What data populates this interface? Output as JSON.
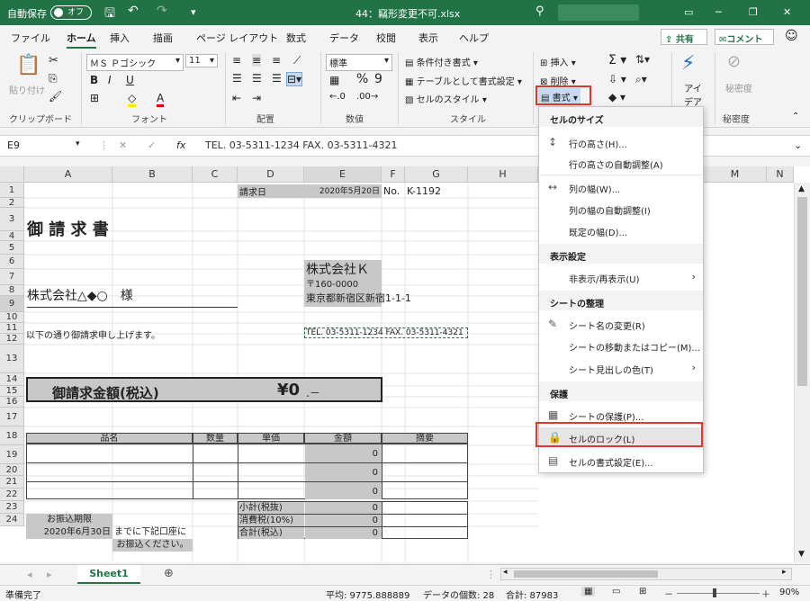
{
  "title": {
    "autosave": "自動保存",
    "toggle": "オフ",
    "filename": "44：竊形変更不可.xlsx"
  },
  "tabs": [
    "ファイル",
    "ホーム",
    "挿入",
    "描画",
    "ページ レイアウト",
    "数式",
    "データ",
    "校閲",
    "表示",
    "ヘルプ"
  ],
  "share": "共有",
  "comment": "コメント",
  "ribbon": {
    "clipboard": {
      "paste": "貼り付け",
      "group": "クリップボード"
    },
    "font": {
      "name": "ＭＳ Ｐゴシック",
      "size": "11",
      "group": "フォント"
    },
    "align": {
      "group": "配置"
    },
    "number": {
      "format": "標準",
      "group": "数値"
    },
    "style": {
      "cond": "条件付き書式",
      "table": "テーブルとして書式設定",
      "cell": "セルのスタイル",
      "group": "スタイル"
    },
    "cells": {
      "insert": "挿入",
      "delete": "削除",
      "format": "書式"
    },
    "ideas": "アイデア",
    "sensitivity": "秘密度"
  },
  "formula": {
    "namebox": "E9",
    "fx": "fx",
    "content": "TEL. 03-5311-1234 FAX. 03-5311-4321"
  },
  "columns": [
    "A",
    "B",
    "C",
    "D",
    "E",
    "F",
    "G",
    "H",
    "M",
    "N"
  ],
  "rows": [
    "1",
    "2",
    "3",
    "4",
    "5",
    "6",
    "7",
    "8",
    "9",
    "10",
    "11",
    "12",
    "13",
    "14",
    "15",
    "16",
    "17",
    "18",
    "19",
    "20",
    "21",
    "22",
    "23",
    "24"
  ],
  "sheet": {
    "d1": "請求日",
    "e1": "2020年5月20日",
    "f1": "No.",
    "g1": "K-1192",
    "a3": "御 請 求 書",
    "e5": "株式会社Ｋ",
    "e6": "〒160-0000",
    "e7": "東京都新宿区新宿1-1-1",
    "a7": "株式会社△◆○　様",
    "a9": "以下の通り御請求申し上げます。",
    "e9": "TEL. 03-5311-1234 FAX. 03-5311-4321",
    "a13": "御請求金額(税込)",
    "d13": "¥0",
    "e13": ".－",
    "h16": [
      "品名",
      "数量",
      "単価",
      "金額",
      "摘要"
    ],
    "zero": "0",
    "d20": "小計(税抜)",
    "d21": "消費税(10%)",
    "d22": "合計(税込)",
    "a21": "お振込期限",
    "a22": "2020年6月30日",
    "b22": "までに下記口座に",
    "b23": "お振込ください。"
  },
  "dropdown": {
    "h1": "セルのサイズ",
    "i1": "行の高さ(H)...",
    "i2": "行の高さの自動調整(A)",
    "i3": "列の幅(W)...",
    "i4": "列の幅の自動調整(I)",
    "i5": "既定の幅(D)...",
    "h2": "表示設定",
    "i6": "非表示/再表示(U)",
    "h3": "シートの整理",
    "i7": "シート名の変更(R)",
    "i8": "シートの移動またはコピー(M)...",
    "i9": "シート見出しの色(T)",
    "h4": "保護",
    "i10": "シートの保護(P)...",
    "i11": "セルのロック(L)",
    "i12": "セルの書式設定(E)..."
  },
  "sheettab": "Sheet1",
  "status": {
    "ready": "準備完了",
    "avg": "平均: 9775.888889",
    "count": "データの個数: 28",
    "sum": "合計: 87983",
    "zoom": "90%"
  },
  "colors": {
    "accent": "#217346",
    "highlight": "#e0392b"
  }
}
